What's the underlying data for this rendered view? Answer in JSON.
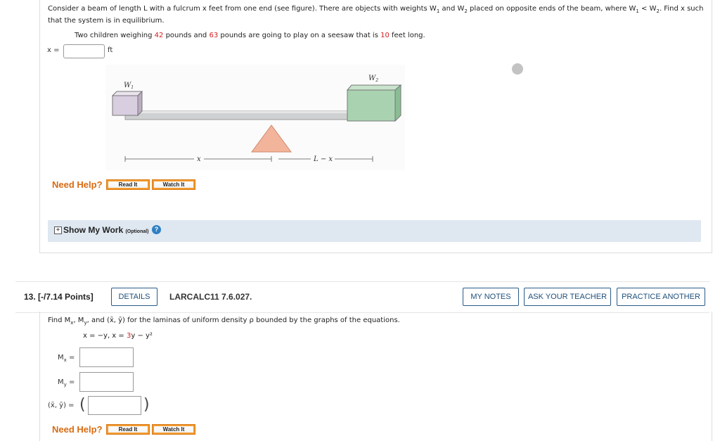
{
  "q12": {
    "problem_line1": "Consider a beam of length L with a fulcrum x feet from one end (see figure). There are objects with weights W",
    "w1_sub": "1",
    "and_text": " and W",
    "w2_sub": "2",
    "line1_rest": " placed on opposite ends of the beam, where W",
    "lt_text": " < W",
    "find_text": ". Find x such",
    "problem_line2": "that the system is in equilibrium.",
    "given_pre": "Two children weighing ",
    "weight1": "42",
    "given_mid1": " pounds and ",
    "weight2": "63",
    "given_mid2": " pounds are going to play on a seesaw that is ",
    "length": "10",
    "given_end": " feet long.",
    "answer_label": "x =",
    "answer_unit": "ft",
    "answer_value": "",
    "figure": {
      "w1_label": "W",
      "w1_sub": "1",
      "w2_label": "W",
      "w2_sub": "2",
      "x_label": "x",
      "lx_label": "L − x"
    },
    "need_help": "Need Help?",
    "read_it": "Read It",
    "watch_it": "Watch It",
    "show_my_work": "Show My Work",
    "optional": "(Optional)"
  },
  "q13": {
    "number": "13.",
    "points": "[-/7.14 Points]",
    "details": "DETAILS",
    "code": "LARCALC11 7.6.027.",
    "my_notes": "MY NOTES",
    "ask_teacher": "ASK YOUR TEACHER",
    "practice": "PRACTICE ANOTHER",
    "prompt_pre": "Find M",
    "prompt_mid": ", and (x̄, ȳ) for the laminas of uniform density ρ bounded by the graphs of the equations.",
    "eq_pre": "x = −y, x = ",
    "eq_coef": "3",
    "eq_post": "y − y²",
    "mx_label": "M",
    "mx_sub": "x",
    "my_sub": "y",
    "eq_sign": "=",
    "centroid_label": "(x̄, ȳ) =",
    "need_help": "Need Help?",
    "read_it": "Read It",
    "watch_it": "Watch It"
  },
  "colors": {
    "accent_red": "#d31f1f",
    "help_orange": "#d96b12",
    "pill_blue": "#1e4f7b",
    "band": "#dfe8f1"
  }
}
